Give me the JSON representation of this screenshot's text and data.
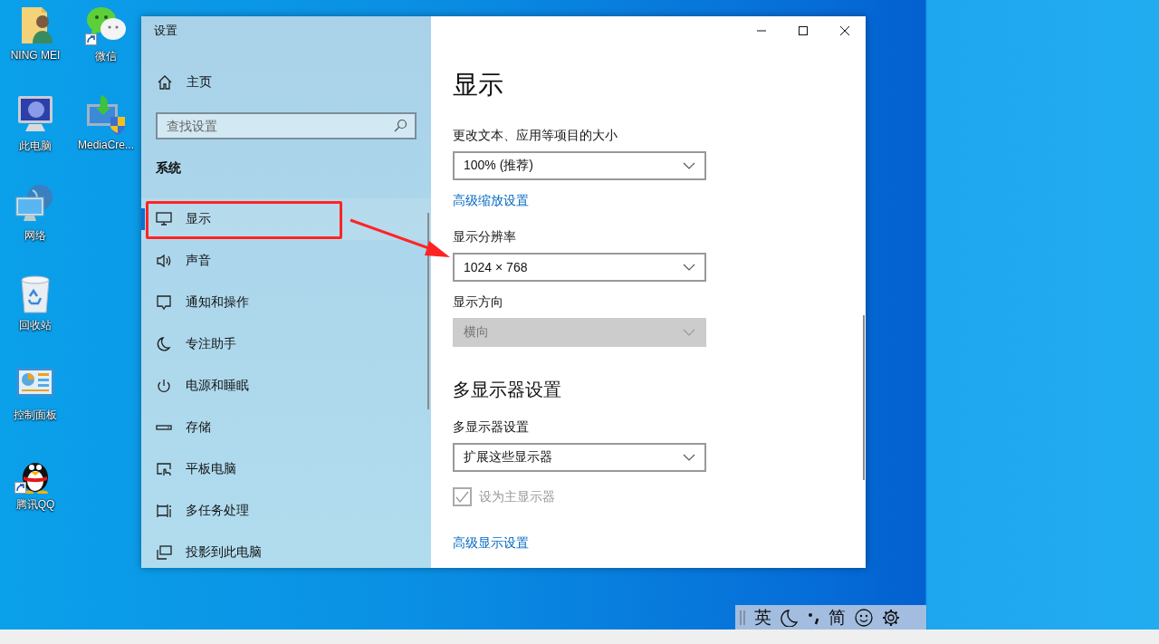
{
  "desktop_columns": [
    {
      "icons": [
        {
          "label": "NING MEI",
          "shortcut": false
        },
        {
          "label": "此电脑",
          "shortcut": false
        },
        {
          "label": "网络",
          "shortcut": false
        },
        {
          "label": "回收站",
          "shortcut": false
        },
        {
          "label": "控制面板",
          "shortcut": false
        },
        {
          "label": "腾讯QQ",
          "shortcut": true
        }
      ]
    },
    {
      "icons": [
        {
          "label": "微信",
          "shortcut": true
        },
        {
          "label": "MediaCre...",
          "shortcut": false
        }
      ]
    }
  ],
  "window": {
    "title": "设置",
    "home": "主页",
    "search_placeholder": "查找设置",
    "section": "系统",
    "nav": [
      {
        "label": "显示",
        "selected": true
      },
      {
        "label": "声音",
        "selected": false
      },
      {
        "label": "通知和操作",
        "selected": false
      },
      {
        "label": "专注助手",
        "selected": false
      },
      {
        "label": "电源和睡眠",
        "selected": false
      },
      {
        "label": "存储",
        "selected": false
      },
      {
        "label": "平板电脑",
        "selected": false
      },
      {
        "label": "多任务处理",
        "selected": false
      },
      {
        "label": "投影到此电脑",
        "selected": false
      }
    ],
    "page_title": "显示",
    "content": [
      {
        "kind": "label",
        "text": "更改文本、应用等项目的大小"
      },
      {
        "kind": "dropdown",
        "value": "100% (推荐)",
        "disabled": false
      },
      {
        "kind": "link",
        "text": "高级缩放设置"
      },
      {
        "kind": "label",
        "text": "显示分辨率"
      },
      {
        "kind": "dropdown",
        "value": "1024 × 768",
        "disabled": false
      },
      {
        "kind": "label",
        "text": "显示方向"
      },
      {
        "kind": "dropdown",
        "value": "横向",
        "disabled": true
      },
      {
        "kind": "heading",
        "text": "多显示器设置"
      },
      {
        "kind": "label",
        "text": "多显示器设置"
      },
      {
        "kind": "dropdown",
        "value": "扩展这些显示器",
        "disabled": false
      },
      {
        "kind": "checkbox",
        "text": "设为主显示器",
        "checked": true,
        "disabled": true
      },
      {
        "kind": "link",
        "text": "高级显示设置"
      }
    ]
  },
  "ime_bar": {
    "language": "英",
    "script": "简"
  }
}
